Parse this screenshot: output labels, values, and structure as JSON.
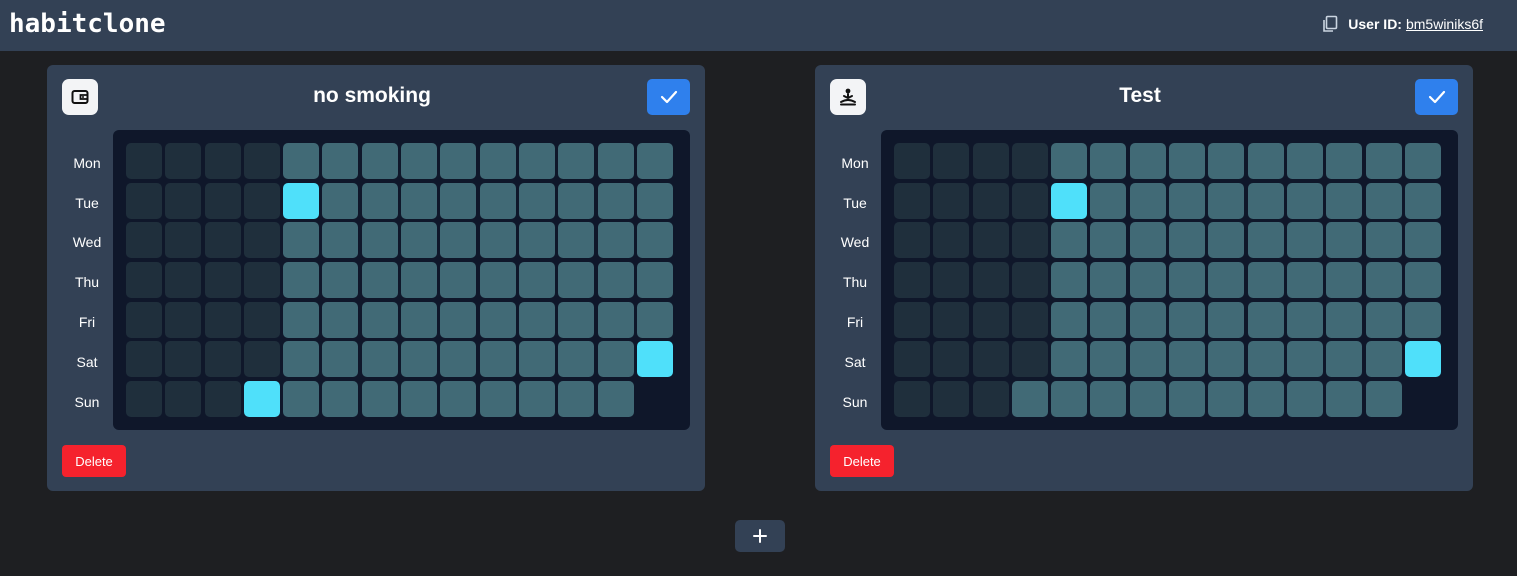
{
  "app": {
    "title": "habitclone"
  },
  "header": {
    "user_id_label": "User ID:",
    "user_id_value": "bm5winiks6f",
    "copy_icon": "copy-icon"
  },
  "colors": {
    "topbar": "#334155",
    "card": "#334155",
    "grid_background": "#0f172a",
    "cell_past": "#1f2f3c",
    "cell_future": "#416a76",
    "cell_done": "#4fe0fa",
    "check_button": "#2f80ed",
    "delete_button": "#f5222d"
  },
  "day_labels": [
    "Mon",
    "Tue",
    "Wed",
    "Thu",
    "Fri",
    "Sat",
    "Sun"
  ],
  "habits": [
    {
      "title": "no smoking",
      "icon": "wallet-icon",
      "delete_label": "Delete",
      "grid": [
        [
          "past",
          "past",
          "past",
          "past",
          "future",
          "future",
          "future",
          "future",
          "future",
          "future",
          "future",
          "future",
          "future",
          "future"
        ],
        [
          "past",
          "past",
          "past",
          "past",
          "done",
          "future",
          "future",
          "future",
          "future",
          "future",
          "future",
          "future",
          "future",
          "future"
        ],
        [
          "past",
          "past",
          "past",
          "past",
          "future",
          "future",
          "future",
          "future",
          "future",
          "future",
          "future",
          "future",
          "future",
          "future"
        ],
        [
          "past",
          "past",
          "past",
          "past",
          "future",
          "future",
          "future",
          "future",
          "future",
          "future",
          "future",
          "future",
          "future",
          "future"
        ],
        [
          "past",
          "past",
          "past",
          "past",
          "future",
          "future",
          "future",
          "future",
          "future",
          "future",
          "future",
          "future",
          "future",
          "future"
        ],
        [
          "past",
          "past",
          "past",
          "past",
          "future",
          "future",
          "future",
          "future",
          "future",
          "future",
          "future",
          "future",
          "future",
          "done"
        ],
        [
          "past",
          "past",
          "past",
          "done",
          "future",
          "future",
          "future",
          "future",
          "future",
          "future",
          "future",
          "future",
          "future",
          "empty"
        ]
      ]
    },
    {
      "title": "Test",
      "icon": "meditation-icon",
      "delete_label": "Delete",
      "grid": [
        [
          "past",
          "past",
          "past",
          "past",
          "future",
          "future",
          "future",
          "future",
          "future",
          "future",
          "future",
          "future",
          "future",
          "future"
        ],
        [
          "past",
          "past",
          "past",
          "past",
          "done",
          "future",
          "future",
          "future",
          "future",
          "future",
          "future",
          "future",
          "future",
          "future"
        ],
        [
          "past",
          "past",
          "past",
          "past",
          "future",
          "future",
          "future",
          "future",
          "future",
          "future",
          "future",
          "future",
          "future",
          "future"
        ],
        [
          "past",
          "past",
          "past",
          "past",
          "future",
          "future",
          "future",
          "future",
          "future",
          "future",
          "future",
          "future",
          "future",
          "future"
        ],
        [
          "past",
          "past",
          "past",
          "past",
          "future",
          "future",
          "future",
          "future",
          "future",
          "future",
          "future",
          "future",
          "future",
          "future"
        ],
        [
          "past",
          "past",
          "past",
          "past",
          "future",
          "future",
          "future",
          "future",
          "future",
          "future",
          "future",
          "future",
          "future",
          "done"
        ],
        [
          "past",
          "past",
          "past",
          "future",
          "future",
          "future",
          "future",
          "future",
          "future",
          "future",
          "future",
          "future",
          "future",
          "empty"
        ]
      ]
    }
  ],
  "add_button": {
    "icon": "plus-icon"
  }
}
